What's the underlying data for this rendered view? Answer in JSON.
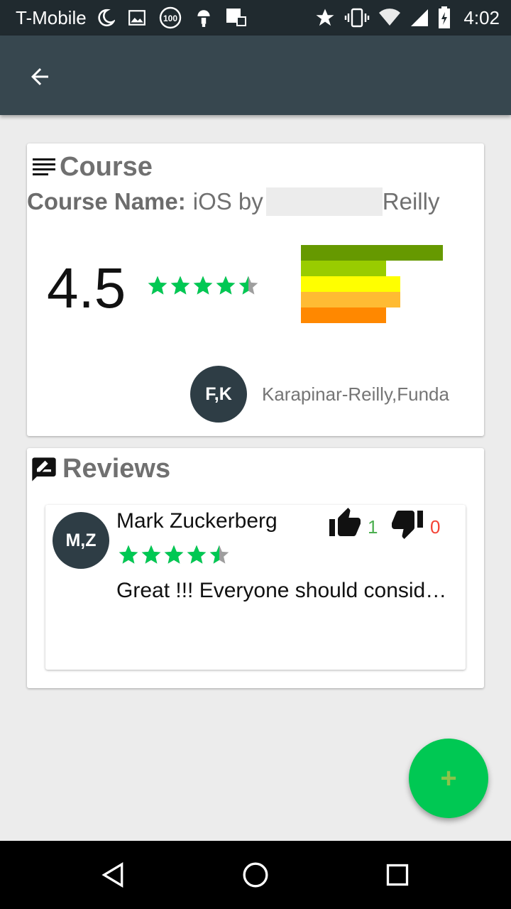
{
  "status_bar": {
    "carrier": "T-Mobile",
    "time": "4:02",
    "left_icons": [
      "moon-icon",
      "image-icon",
      "battery-100-icon",
      "android-icon",
      "notes-icon"
    ],
    "right_icons": [
      "star-icon",
      "vibrate-icon",
      "wifi-icon",
      "signal-icon",
      "battery-charging-icon"
    ]
  },
  "toolbar": {
    "back_icon": "arrow-left-icon"
  },
  "course_card": {
    "title": "Course",
    "title_icon": "list-icon",
    "name_label": "Course Name:",
    "name_prefix": "iOS by",
    "name_suffix": "Reilly",
    "rating": "4.5",
    "stars": 4.5,
    "distribution": [
      {
        "stars": 5,
        "fraction": 1.0,
        "color": "#669900"
      },
      {
        "stars": 4,
        "fraction": 0.6,
        "color": "#99cc00"
      },
      {
        "stars": 3,
        "fraction": 0.7,
        "color": "#ffff00"
      },
      {
        "stars": 2,
        "fraction": 0.7,
        "color": "#ffbb33"
      },
      {
        "stars": 1,
        "fraction": 0.6,
        "color": "#ff8800"
      }
    ],
    "instructor_initials": "F,K",
    "instructor_name": "Karapinar-Reilly,Funda"
  },
  "reviews_card": {
    "title": "Reviews",
    "title_icon": "rate-review-icon",
    "reviews": [
      {
        "initials": "M,Z",
        "name": "Mark Zuckerberg",
        "stars": 4.5,
        "text": "Great !!! Everyone should consid…",
        "likes": "1",
        "dislikes": "0",
        "like_color": "#4caf50",
        "dislike_color": "#f44336"
      }
    ]
  },
  "fab": {
    "label": "+"
  },
  "colors": {
    "star": "#00c853",
    "primary": "#37474f",
    "status": "#202a2f",
    "accent": "#00c853"
  },
  "nav": {
    "icons": [
      "back-triangle-icon",
      "home-circle-icon",
      "recents-square-icon"
    ]
  }
}
